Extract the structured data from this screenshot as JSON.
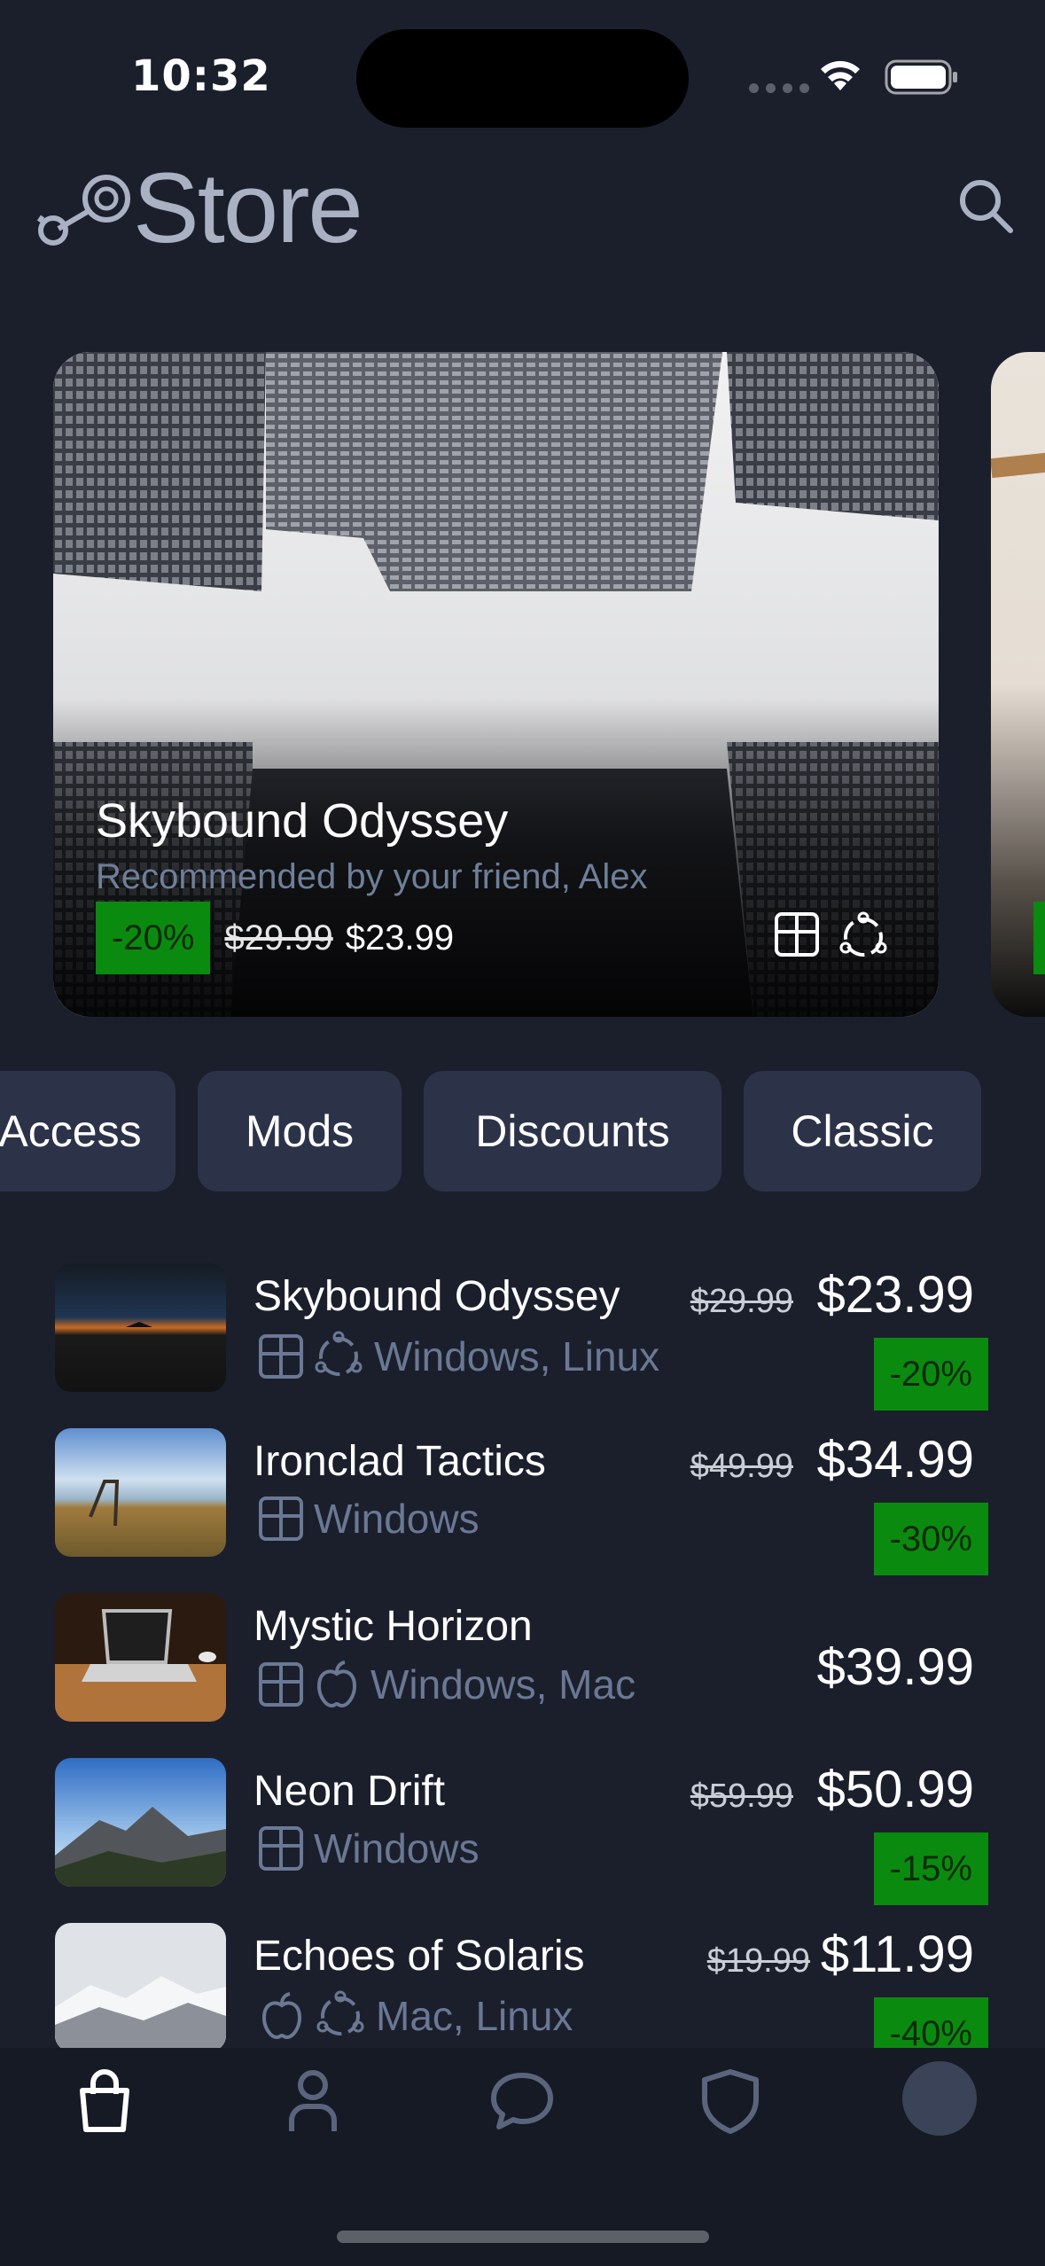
{
  "status_bar": {
    "time": "10:32"
  },
  "header": {
    "title": "Store",
    "logo_icon": "steam-logo-icon",
    "search_icon": "search-icon"
  },
  "featured": {
    "title": "Skybound Odyssey",
    "subtitle": "Recommended by your friend, Alex",
    "discount": "-20%",
    "original_price": "$29.99",
    "final_price": "$23.99",
    "platform_icons": [
      "windows-icon",
      "linux-icon"
    ]
  },
  "categories": [
    "Access",
    "Mods",
    "Discounts",
    "Classic"
  ],
  "games": [
    {
      "title": "Skybound Odyssey",
      "platforms": "Windows, Linux",
      "platform_icons": [
        "windows-icon",
        "linux-icon"
      ],
      "original_price": "$29.99",
      "final_price": "$23.99",
      "discount": "-20%"
    },
    {
      "title": "Ironclad Tactics",
      "platforms": "Windows",
      "platform_icons": [
        "windows-icon"
      ],
      "original_price": "$49.99",
      "final_price": "$34.99",
      "discount": "-30%"
    },
    {
      "title": "Mystic Horizon",
      "platforms": "Windows, Mac",
      "platform_icons": [
        "windows-icon",
        "apple-icon"
      ],
      "original_price": "",
      "final_price": "$39.99",
      "discount": ""
    },
    {
      "title": "Neon Drift",
      "platforms": "Windows",
      "platform_icons": [
        "windows-icon"
      ],
      "original_price": "$59.99",
      "final_price": "$50.99",
      "discount": "-15%"
    },
    {
      "title": "Echoes of Solaris",
      "platforms": "Mac, Linux",
      "platform_icons": [
        "apple-icon",
        "linux-icon"
      ],
      "original_price": "$19.99",
      "final_price": "$11.99",
      "discount": "-40%"
    }
  ],
  "tabbar": {
    "tabs": [
      "store-bag-icon",
      "profile-icon",
      "chat-icon",
      "shield-icon",
      "avatar"
    ],
    "active": "store-bag-icon"
  },
  "colors": {
    "background": "#1b1f2c",
    "chip": "#2c3349",
    "discount_green": "#0b8a10",
    "platform_text": "#6a7894"
  }
}
